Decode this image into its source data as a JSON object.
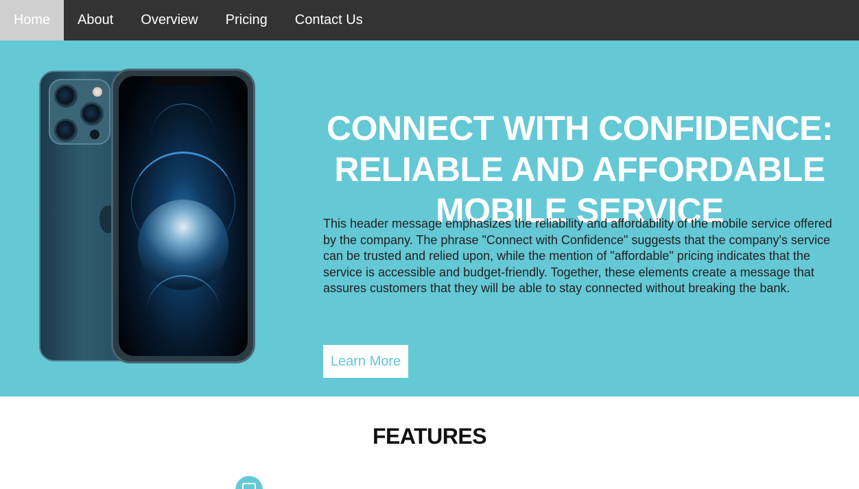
{
  "nav": {
    "items": [
      {
        "label": "Home",
        "active": true
      },
      {
        "label": "About",
        "active": false
      },
      {
        "label": "Overview",
        "active": false
      },
      {
        "label": "Pricing",
        "active": false
      },
      {
        "label": "Contact Us",
        "active": false
      }
    ]
  },
  "hero": {
    "title": "CONNECT WITH CONFIDENCE: RELIABLE AND AFFORDABLE MOBILE SERVICE",
    "description": "This header message emphasizes the reliability and affordability of the mobile service offered by the company. The phrase \"Connect with Confidence\" suggests that the company's service can be trusted and relied upon, while the mention of \"affordable\" pricing indicates that the service is accessible and budget-friendly. Together, these elements create a message that assures customers that they will be able to stay connected without breaking the bank.",
    "button_label": "Learn More",
    "background_color": "#64c8d5"
  },
  "features": {
    "title": "FEATURES",
    "icon": "chat-icon"
  },
  "colors": {
    "nav_bg": "#333333",
    "nav_active_bg": "#cfcfcf",
    "accent": "#64c8d5"
  }
}
